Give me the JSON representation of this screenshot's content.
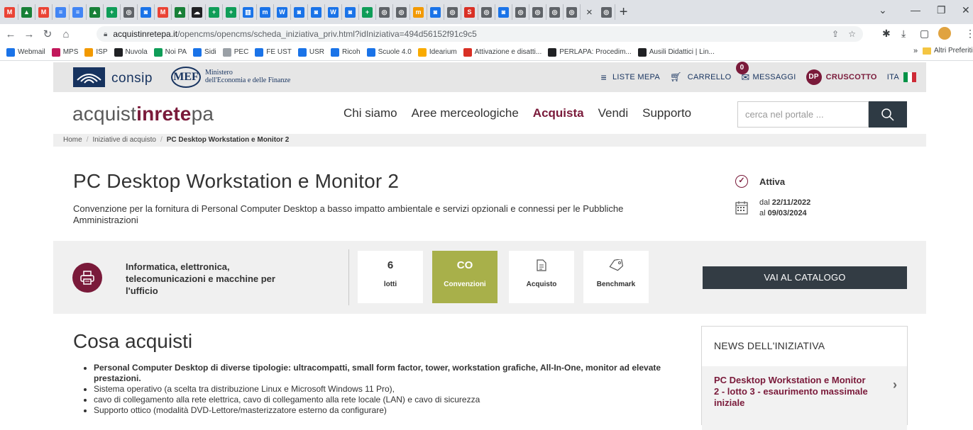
{
  "browser": {
    "url_host": "acquistinretepa.it",
    "url_path": "/opencms/opencms/scheda_iniziativa_priv.html?idIniziativa=494d56152f91c9c5",
    "tabs": [
      {
        "icon": "gmail-icon",
        "glyph": "M",
        "color": "#ea4335"
      },
      {
        "icon": "drive-icon",
        "glyph": "▲",
        "color": "#188038"
      },
      {
        "icon": "gmail-icon",
        "glyph": "M",
        "color": "#ea4335"
      },
      {
        "icon": "docs-icon",
        "glyph": "≡",
        "color": "#4285f4"
      },
      {
        "icon": "docs-icon",
        "glyph": "≡",
        "color": "#4285f4"
      },
      {
        "icon": "drive-icon",
        "glyph": "▲",
        "color": "#188038"
      },
      {
        "icon": "sheets-icon",
        "glyph": "+",
        "color": "#0f9d58"
      },
      {
        "icon": "globe-icon",
        "glyph": "◎",
        "color": "#5f6368"
      },
      {
        "icon": "site-icon",
        "glyph": "◙",
        "color": "#1a73e8"
      },
      {
        "icon": "gmail-icon",
        "glyph": "M",
        "color": "#ea4335"
      },
      {
        "icon": "drive-icon",
        "glyph": "▲",
        "color": "#188038"
      },
      {
        "icon": "cloud-icon",
        "glyph": "☁",
        "color": "#202124"
      },
      {
        "icon": "sheets-icon",
        "glyph": "+",
        "color": "#0f9d58"
      },
      {
        "icon": "sheets-icon",
        "glyph": "+",
        "color": "#0f9d58"
      },
      {
        "icon": "forms-icon",
        "glyph": "▥",
        "color": "#1a73e8"
      },
      {
        "icon": "m-icon",
        "glyph": "m",
        "color": "#1a73e8"
      },
      {
        "icon": "wordpress-icon",
        "glyph": "W",
        "color": "#1a73e8"
      },
      {
        "icon": "site-icon",
        "glyph": "◙",
        "color": "#1a73e8"
      },
      {
        "icon": "site-icon",
        "glyph": "◙",
        "color": "#1a73e8"
      },
      {
        "icon": "wordpress-icon",
        "glyph": "W",
        "color": "#1a73e8"
      },
      {
        "icon": "site-icon",
        "glyph": "◙",
        "color": "#1a73e8"
      },
      {
        "icon": "sheets-icon",
        "glyph": "+",
        "color": "#0f9d58"
      },
      {
        "icon": "globe-icon",
        "glyph": "◎",
        "color": "#5f6368"
      },
      {
        "icon": "globe-icon",
        "glyph": "◎",
        "color": "#5f6368"
      },
      {
        "icon": "m-icon",
        "glyph": "m",
        "color": "#f29900"
      },
      {
        "icon": "site-icon",
        "glyph": "◙",
        "color": "#1a73e8"
      },
      {
        "icon": "globe-icon",
        "glyph": "◎",
        "color": "#5f6368"
      },
      {
        "icon": "s-icon",
        "glyph": "S",
        "color": "#d93025"
      },
      {
        "icon": "globe-icon",
        "glyph": "◎",
        "color": "#5f6368"
      },
      {
        "icon": "site-icon",
        "glyph": "◙",
        "color": "#1a73e8"
      },
      {
        "icon": "globe-icon",
        "glyph": "◎",
        "color": "#5f6368"
      },
      {
        "icon": "globe-icon",
        "glyph": "◎",
        "color": "#5f6368"
      },
      {
        "icon": "globe-icon",
        "glyph": "◎",
        "color": "#5f6368"
      },
      {
        "icon": "globe-icon",
        "glyph": "◎",
        "color": "#5f6368"
      },
      {
        "icon": "globe-icon",
        "glyph": "◎",
        "color": "#5f6368"
      }
    ],
    "bookmarks": [
      {
        "label": "Webmail",
        "color": "#1a73e8"
      },
      {
        "label": "MPS",
        "color": "#c2185b"
      },
      {
        "label": "ISP",
        "color": "#f29900"
      },
      {
        "label": "Nuvola",
        "color": "#202124"
      },
      {
        "label": "Noi PA",
        "color": "#0f9d58"
      },
      {
        "label": "Sidi",
        "color": "#1a73e8"
      },
      {
        "label": "PEC",
        "color": "#9aa0a6"
      },
      {
        "label": "FE UST",
        "color": "#1a73e8"
      },
      {
        "label": "USR",
        "color": "#1a73e8"
      },
      {
        "label": "Ricoh",
        "color": "#1a73e8"
      },
      {
        "label": "Scuole 4.0",
        "color": "#1a73e8"
      },
      {
        "label": "Idearium",
        "color": "#f9ab00"
      },
      {
        "label": "Attivazione e disatti...",
        "color": "#d93025"
      },
      {
        "label": "PERLAPA: Procedim...",
        "color": "#202124"
      },
      {
        "label": "Ausili Didattici | Lin...",
        "color": "#202124"
      }
    ],
    "bookmarks_more": "»",
    "bookmarks_other": "Altri Preferiti"
  },
  "header": {
    "consip": "consip",
    "mef": "MEF",
    "ministero_line1": "Ministero",
    "ministero_line2": "dell'Economia e delle Finanze",
    "liste_mepa": "LISTE MEPA",
    "carrello": "CARRELLO",
    "messaggi": "MESSAGGI",
    "messaggi_count": "0",
    "user_initials": "DP",
    "cruscotto": "CRUSCOTTO",
    "lang": "ITA"
  },
  "brand": {
    "part1": "acquist",
    "part2": "inrete",
    "part3": "pa"
  },
  "nav": {
    "items": [
      "Chi siamo",
      "Aree merceologiche",
      "Acquista",
      "Vendi",
      "Supporto"
    ],
    "active": "Acquista",
    "search_placeholder": "cerca nel portale ..."
  },
  "breadcrumb": {
    "home": "Home",
    "level1": "Iniziative di acquisto",
    "current": "PC Desktop Workstation e Monitor 2"
  },
  "initiative": {
    "title": "PC Desktop Workstation e Monitor 2",
    "description": "Convenzione per la fornitura di Personal Computer Desktop a basso impatto ambientale e servizi opzionali e connessi per le Pubbliche Amministrazioni",
    "status": "Attiva",
    "date_from_label": "dal",
    "date_from": "22/11/2022",
    "date_to_label": "al",
    "date_to": "09/03/2024"
  },
  "panel": {
    "category": "Informatica, elettronica, telecomunicazioni e macchine per l'ufficio",
    "cards": [
      {
        "big": "6",
        "label": "lotti",
        "selected": false
      },
      {
        "big": "CO",
        "label": "Convenzioni",
        "selected": true
      },
      {
        "big": "",
        "label": "Acquisto",
        "icon": "document-icon",
        "selected": false
      },
      {
        "big": "",
        "label": "Benchmark",
        "icon": "tag-icon",
        "selected": false
      }
    ],
    "catalog_button": "VAI AL CATALOGO"
  },
  "content": {
    "heading": "Cosa acquisti",
    "bullets": [
      {
        "text": "Personal Computer Desktop di diverse tipologie: ultracompatti, small form factor, tower, workstation grafiche, All-In-One, monitor ad elevate prestazioni.",
        "bold": true
      },
      {
        "text": "Sistema operativo (a scelta tra distribuzione Linux e Microsoft Windows 11 Pro),",
        "bold": false
      },
      {
        "text": "cavo di collegamento alla rete elettrica, cavo di collegamento alla rete locale (LAN) e cavo di sicurezza",
        "bold": false
      },
      {
        "text": "Supporto ottico (modalità DVD-Lettore/masterizzatore esterno da configurare)",
        "bold": false
      }
    ]
  },
  "news": {
    "heading": "NEWS DELL'INIZIATIVA",
    "item": "PC Desktop Workstation e Monitor 2 - lotto 3 - esaurimento massimale iniziale"
  },
  "colors": {
    "brand": "#7a1a3a",
    "accent_green": "#a8b04a",
    "dark_button": "#333c44",
    "navy": "#17335f"
  }
}
